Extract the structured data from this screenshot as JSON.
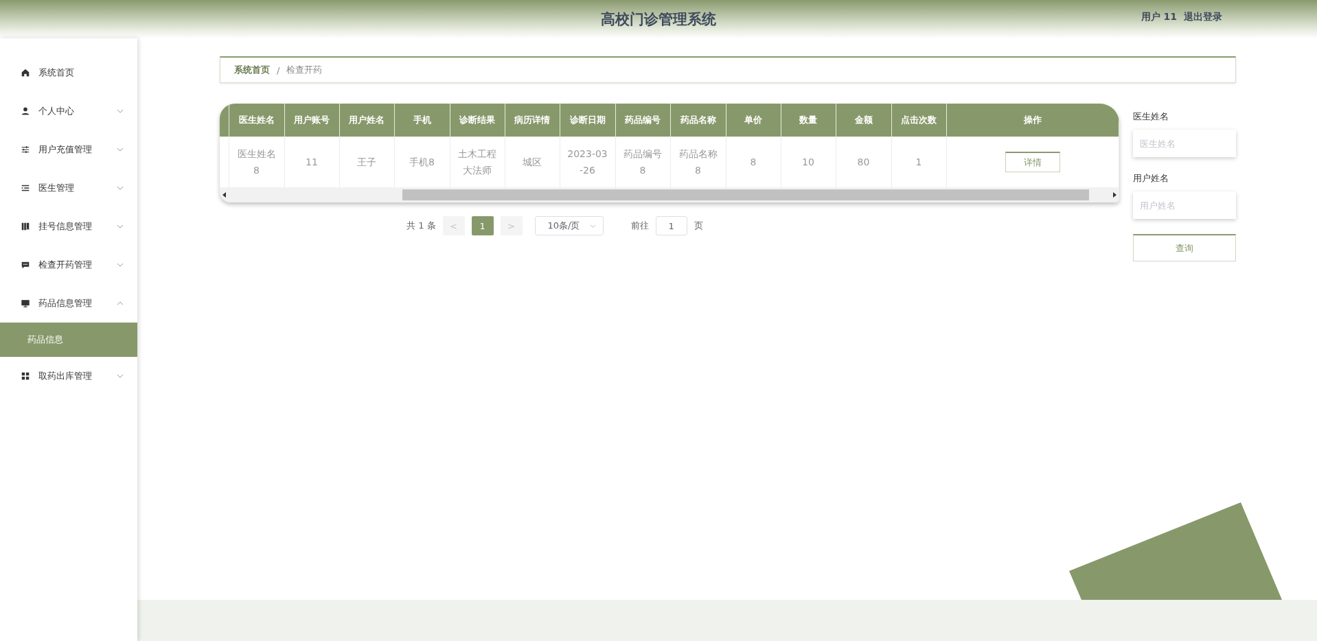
{
  "header": {
    "title": "高校门诊管理系统",
    "user": "用户 11",
    "logout": "退出登录"
  },
  "sidebar": {
    "items": [
      {
        "label": "系统首页",
        "expandable": false
      },
      {
        "label": "个人中心",
        "expandable": true,
        "expanded": false
      },
      {
        "label": "用户充值管理",
        "expandable": true,
        "expanded": false
      },
      {
        "label": "医生管理",
        "expandable": true,
        "expanded": false
      },
      {
        "label": "挂号信息管理",
        "expandable": true,
        "expanded": false
      },
      {
        "label": "检查开药管理",
        "expandable": true,
        "expanded": false
      },
      {
        "label": "药品信息管理",
        "expandable": true,
        "expanded": true,
        "children": [
          {
            "label": "药品信息",
            "selected": true
          }
        ]
      },
      {
        "label": "取药出库管理",
        "expandable": true,
        "expanded": false
      }
    ]
  },
  "breadcrumb": [
    "系统首页",
    "检查开药"
  ],
  "breadcrumb_separator": "/",
  "table": {
    "columns": [
      "医生姓名",
      "用户账号",
      "用户姓名",
      "手机",
      "诊断结果",
      "病历详情",
      "诊断日期",
      "药品编号",
      "药品名称",
      "单价",
      "数量",
      "金额",
      "点击次数",
      "操作"
    ],
    "rows": [
      {
        "cells": [
          "医生姓名8",
          "11",
          "王子",
          "手机8",
          "土木工程大法师",
          "城区",
          "2023-03-26",
          "药品编号8",
          "药品名称8",
          "8",
          "10",
          "80",
          "1"
        ],
        "action": "详情"
      }
    ]
  },
  "pagination": {
    "total": "共 1 条",
    "prev": "<",
    "pages": [
      {
        "label": "1",
        "selected": true
      }
    ],
    "next": ">",
    "page_size": "10条/页",
    "goto_label": "前往",
    "goto_value": "1",
    "goto_suffix": "页"
  },
  "search": {
    "fields": [
      {
        "label": "医生姓名",
        "placeholder": "医生姓名"
      },
      {
        "label": "用户姓名",
        "placeholder": "用户姓名"
      }
    ],
    "button": "查询"
  }
}
